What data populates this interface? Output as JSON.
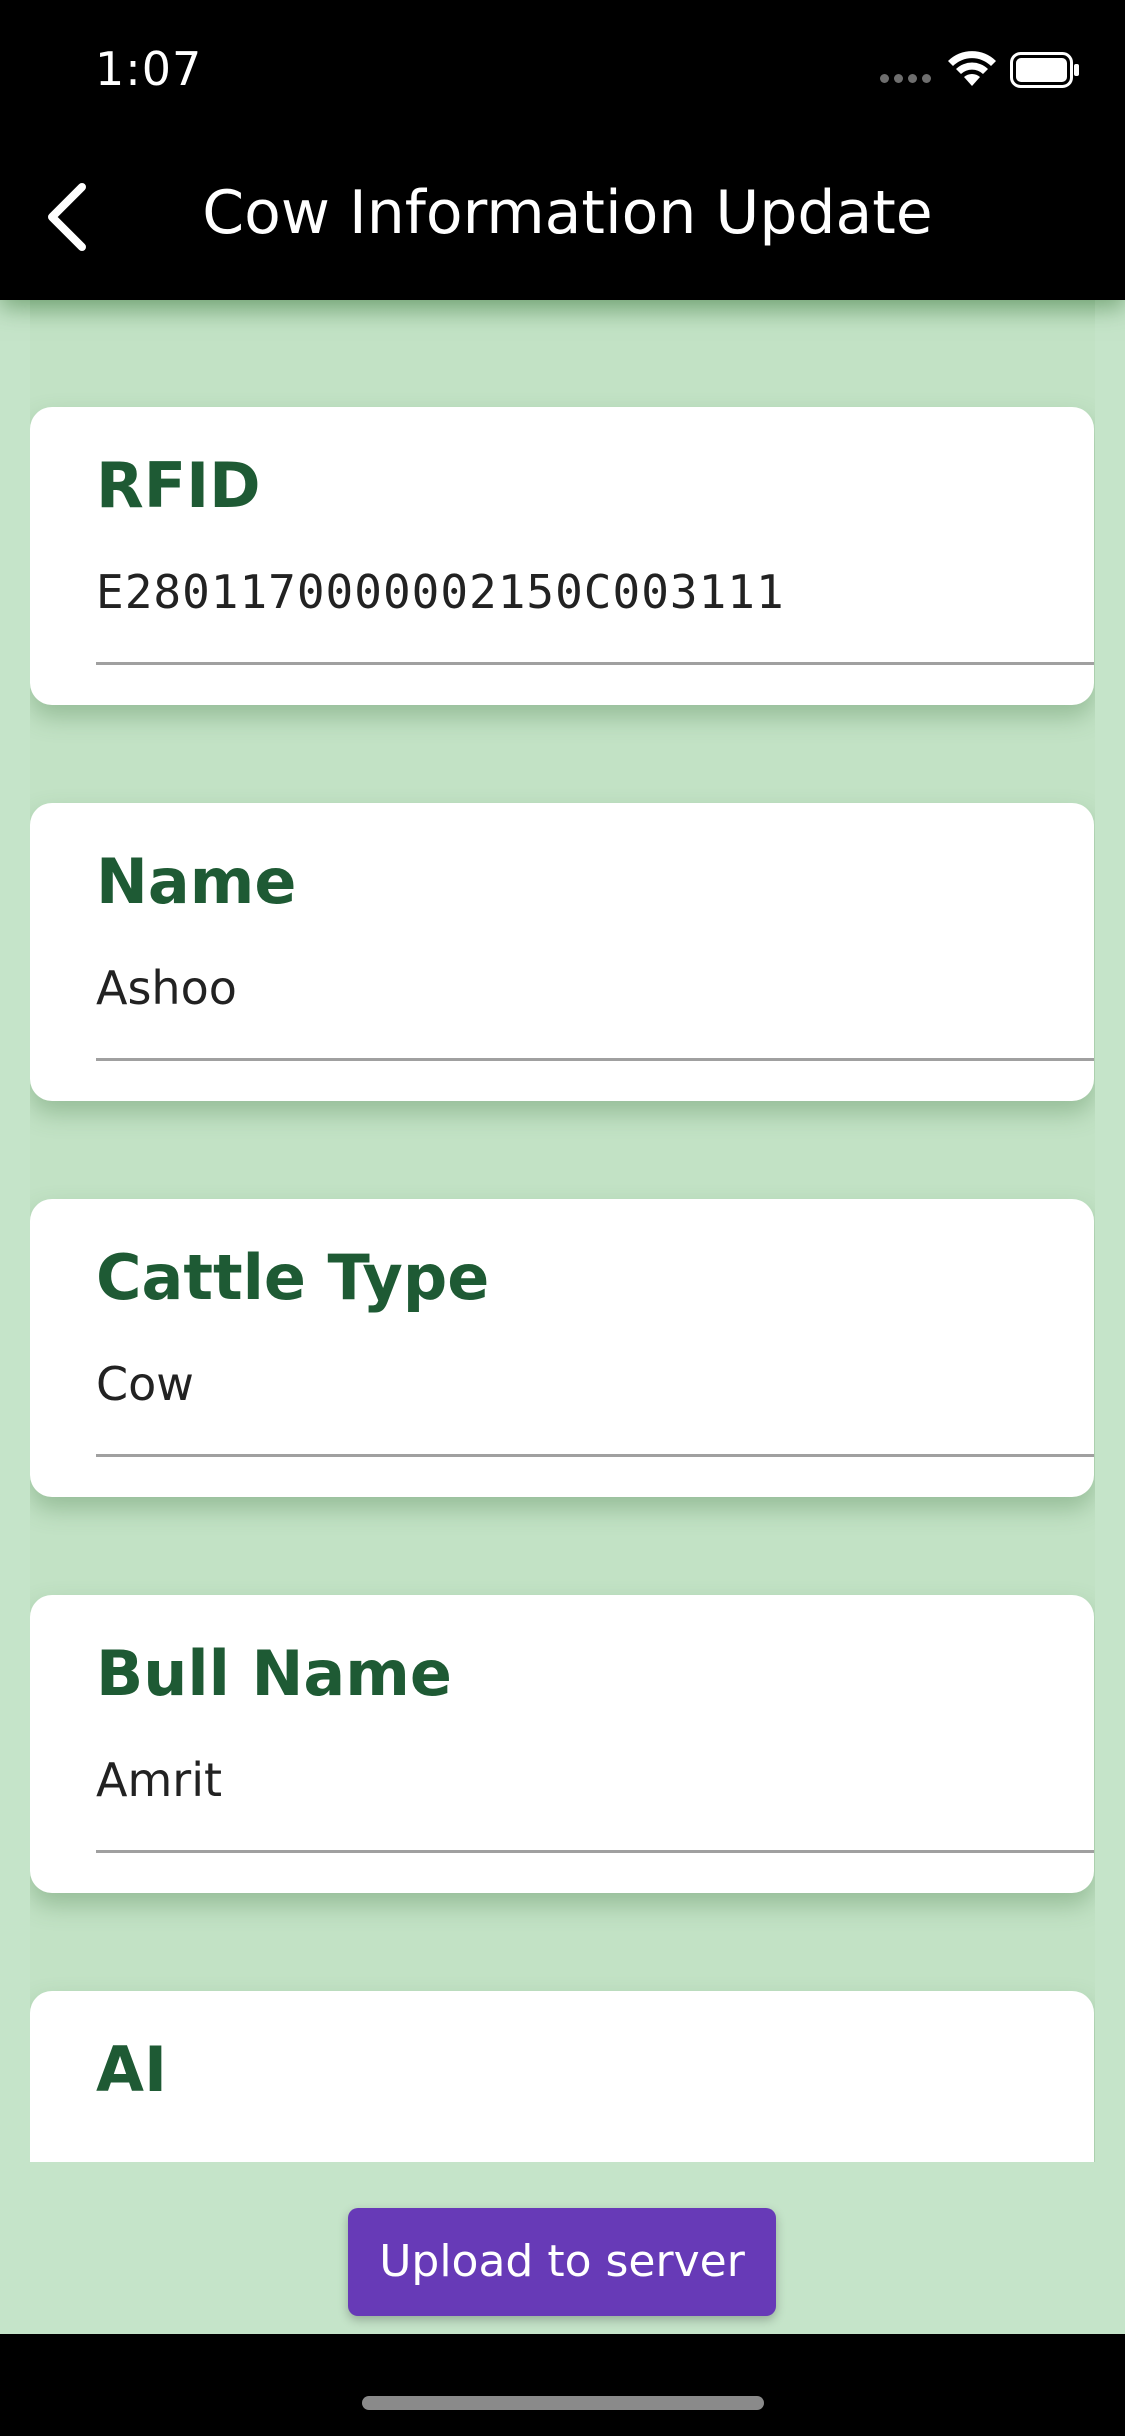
{
  "status_bar": {
    "time": "1:07"
  },
  "app_bar": {
    "title": "Cow Information Update",
    "back_icon": "chevron-left-icon"
  },
  "fields": [
    {
      "label": "RFID",
      "value": "E2801170000002150C003111"
    },
    {
      "label": "Name",
      "value": "Ashoo"
    },
    {
      "label": "Cattle Type",
      "value": "Cow"
    },
    {
      "label": "Bull Name",
      "value": "Amrit"
    },
    {
      "label": "AI",
      "value": ""
    }
  ],
  "actions": {
    "upload_label": "Upload to server"
  },
  "colors": {
    "background": "#c5e4c9",
    "app_bar": "#000000",
    "label": "#1e5a34",
    "button": "#673ab7"
  }
}
